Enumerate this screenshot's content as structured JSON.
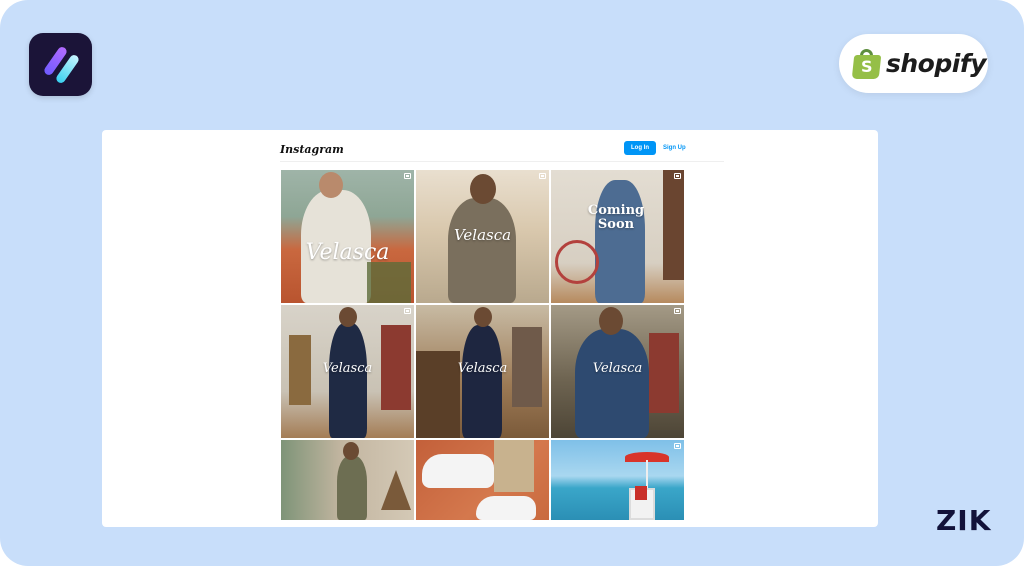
{
  "app": {
    "name": "Instagram",
    "login_label": "Log In",
    "signup_label": "Sign Up"
  },
  "branding": {
    "shopify_word": "shopify",
    "shopify_bag_letter": "S",
    "zik_word": "ZIK"
  },
  "posts": [
    {
      "overlay": "Velasca",
      "badge": true
    },
    {
      "overlay": "Velasca",
      "badge": true
    },
    {
      "overlay": "Coming Soon",
      "badge": true
    },
    {
      "overlay": "Velasca",
      "badge": true
    },
    {
      "overlay": "Velasca",
      "badge": false
    },
    {
      "overlay": "Velasca",
      "badge": true
    },
    {
      "overlay": "",
      "badge": false
    },
    {
      "overlay": "",
      "badge": false
    },
    {
      "overlay": "",
      "badge": true
    }
  ],
  "colors": {
    "background": "#c8defa",
    "instagram_blue": "#0095f6",
    "shopify_green": "#95bf47",
    "app_logo_bg": "#1b1438",
    "zik_text": "#12123a"
  }
}
